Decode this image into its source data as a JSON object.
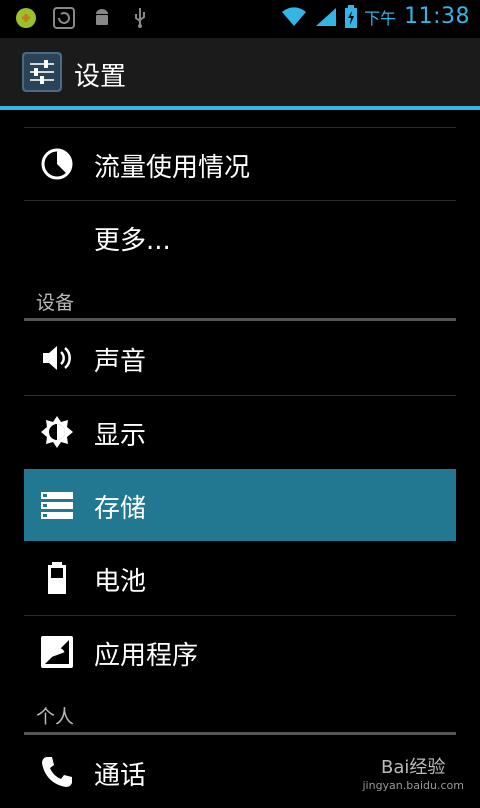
{
  "statusbar": {
    "icons": [
      "notification-app-icon",
      "sync-icon",
      "android-debug-icon",
      "usb-icon",
      "wifi-icon",
      "signal-icon",
      "battery-charging-icon"
    ],
    "ampm": "下午",
    "time": "11:38"
  },
  "actionbar": {
    "title": "设置"
  },
  "list": {
    "items": [
      {
        "label": "流量使用情况",
        "icon": "data-usage-icon"
      },
      {
        "label": "更多...",
        "icon": ""
      },
      {
        "label": "声音",
        "icon": "sound-icon"
      },
      {
        "label": "显示",
        "icon": "display-icon"
      },
      {
        "label": "存储",
        "icon": "storage-icon"
      },
      {
        "label": "电池",
        "icon": "battery-icon"
      },
      {
        "label": "应用程序",
        "icon": "apps-icon"
      },
      {
        "label": "通话",
        "icon": "phone-icon"
      }
    ],
    "sections": [
      {
        "header": "设备"
      },
      {
        "header": "个人"
      }
    ]
  },
  "watermark": {
    "brand": "Bai经验",
    "url": "jingyan.baidu.com"
  },
  "colors": {
    "accent": "#33b5e5",
    "selected": "#227891"
  }
}
